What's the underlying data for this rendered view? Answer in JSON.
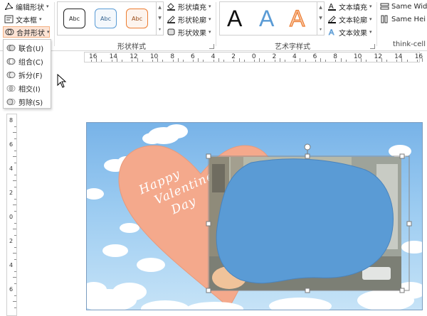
{
  "ribbon": {
    "insert_shapes": {
      "edit_shape": "编辑形状",
      "text_box": "文本框",
      "merge_shapes": "合并形状"
    },
    "shape_styles": {
      "label": "形状样式",
      "gallery": [
        "Abc",
        "Abc",
        "Abc"
      ],
      "fill": "形状填充",
      "outline": "形状轮廓",
      "effects": "形状效果"
    },
    "wordart_styles": {
      "label": "艺术字样式",
      "letters": [
        "A",
        "A",
        "A"
      ],
      "text_fill": "文本填充",
      "text_outline": "文本轮廓",
      "text_effects": "文本效果"
    },
    "thinkcell": {
      "label": "think-cell",
      "same_width": "Same Wid",
      "same_height": "Same Hei"
    }
  },
  "merge_menu": {
    "items": [
      {
        "label": "联合(U)",
        "icon": "union-icon"
      },
      {
        "label": "组合(C)",
        "icon": "combine-icon"
      },
      {
        "label": "拆分(F)",
        "icon": "fragment-icon"
      },
      {
        "label": "相交(I)",
        "icon": "intersect-icon"
      },
      {
        "label": "剪除(S)",
        "icon": "subtract-icon"
      }
    ]
  },
  "ruler": {
    "numbers": [
      "16",
      "14",
      "12",
      "10",
      "8",
      "6",
      "4",
      "2",
      "0",
      "2",
      "4",
      "6",
      "8",
      "10",
      "12",
      "14",
      "16"
    ],
    "vnumbers": [
      "8",
      "6",
      "4",
      "2",
      "0",
      "2",
      "4",
      "6"
    ]
  },
  "slide": {
    "heart_text": [
      "Happy",
      "Valentine",
      "Day"
    ]
  },
  "colors": {
    "accent": "#f4b183",
    "sky": "#8ec4ef",
    "heart": "#f4a98c",
    "blob": "#5a9bd5"
  }
}
